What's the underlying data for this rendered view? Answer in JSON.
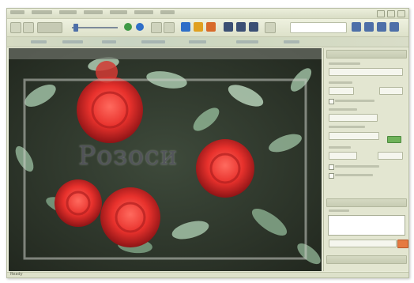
{
  "window": {
    "menu_items": [
      "",
      "",
      "",
      "",
      "",
      "",
      ""
    ],
    "accent_color": "#4d6fa8"
  },
  "toolbar": {
    "icons": [
      {
        "name": "back-icon",
        "color": "#8a8f7e"
      },
      {
        "name": "forward-icon",
        "color": "#8a8f7e"
      },
      {
        "name": "zoom-slider-icon",
        "color": "#4d6fa8"
      },
      {
        "name": "play-icon",
        "color": "#3f9a46"
      },
      {
        "name": "next-icon",
        "color": "#2f6fc8"
      },
      {
        "name": "rotate-icon",
        "color": "#8a8f7e"
      },
      {
        "name": "crop-icon",
        "color": "#2f6fc8"
      },
      {
        "name": "adjust-icon",
        "color": "#e0a020"
      },
      {
        "name": "filter-icon",
        "color": "#d86a2a"
      },
      {
        "name": "grid-view-icon",
        "color": "#3b4f74"
      },
      {
        "name": "film-view-icon",
        "color": "#3b4f74"
      },
      {
        "name": "compare-icon",
        "color": "#3b4f74"
      },
      {
        "name": "info-icon",
        "color": "#8a8f7e"
      },
      {
        "name": "help-icon",
        "color": "#4d6fa8"
      },
      {
        "name": "settings-icon",
        "color": "#4d6fa8"
      },
      {
        "name": "layout-icon",
        "color": "#4d6fa8"
      },
      {
        "name": "window-icon",
        "color": "#4d6fa8"
      }
    ],
    "search_placeholder": ""
  },
  "canvas": {
    "overlay_text": "Розоси"
  },
  "status": {
    "text": "Ready"
  }
}
